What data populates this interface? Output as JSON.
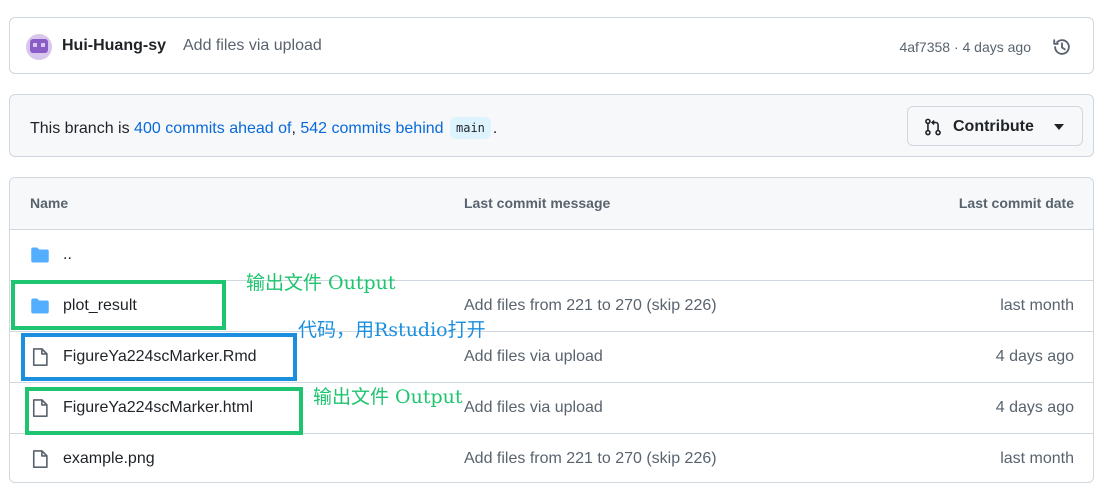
{
  "commit_bar": {
    "author": "Hui-Huang-sy",
    "message": "Add files via upload",
    "meta": "4af7358 · 4 days ago"
  },
  "branch_bar": {
    "prefix": "This branch is ",
    "ahead": "400 commits ahead of",
    "separator": ", ",
    "behind": "542 commits behind",
    "branch": "main",
    "suffix": ".",
    "contribute_label": "Contribute"
  },
  "table": {
    "headers": {
      "name": "Name",
      "message": "Last commit message",
      "date": "Last commit date"
    },
    "rows": [
      {
        "type": "folder",
        "name": "..",
        "message": "",
        "date": ""
      },
      {
        "type": "folder",
        "name": "plot_result",
        "message": "Add files from 221 to 270 (skip 226)",
        "date": "last month"
      },
      {
        "type": "file",
        "name": "FigureYa224scMarker.Rmd",
        "message": "Add files via upload",
        "date": "4 days ago"
      },
      {
        "type": "file",
        "name": "FigureYa224scMarker.html",
        "message": "Add files via upload",
        "date": "4 days ago"
      },
      {
        "type": "file",
        "name": "example.png",
        "message": "Add files from 221 to 270 (skip 226)",
        "date": "last month"
      }
    ]
  },
  "annotations": {
    "output_1": "输出文件 Output",
    "code": "代码，用Rstudio打开",
    "output_2": "输出文件 Output",
    "colors": {
      "green": "#1ec46f",
      "blue": "#1a8fe0"
    }
  },
  "colors": {
    "link": "#0969da",
    "folder_icon": "#54aeff",
    "muted_text": "#59636e",
    "border": "#d0d7de"
  }
}
